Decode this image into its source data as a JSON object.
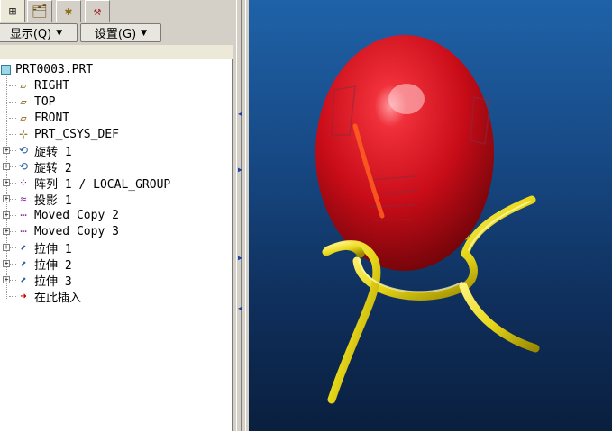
{
  "tabs": [
    {
      "icon": "model-tree-icon",
      "glyph": "⊞",
      "active": true
    },
    {
      "icon": "folder-browser-icon",
      "glyph": "🗂"
    },
    {
      "icon": "favorites-icon",
      "glyph": "✱"
    },
    {
      "icon": "tools-icon",
      "glyph": "⚒"
    }
  ],
  "toolbar": {
    "display_label": "显示(Q)",
    "settings_label": "设置(G)"
  },
  "tree": {
    "root": "PRT0003.PRT",
    "items": [
      {
        "label": "RIGHT",
        "icon": "datum-plane-icon",
        "glyph": "▱",
        "expandable": false
      },
      {
        "label": "TOP",
        "icon": "datum-plane-icon",
        "glyph": "▱",
        "expandable": false
      },
      {
        "label": "FRONT",
        "icon": "datum-plane-icon",
        "glyph": "▱",
        "expandable": false
      },
      {
        "label": "PRT_CSYS_DEF",
        "icon": "coordinate-system-icon",
        "glyph": "⊹",
        "expandable": false
      },
      {
        "label": "旋转 1",
        "icon": "revolve-icon",
        "glyph": "⟲",
        "expandable": true
      },
      {
        "label": "旋转 2",
        "icon": "revolve-icon",
        "glyph": "⟲",
        "expandable": true
      },
      {
        "label": "阵列 1 / LOCAL_GROUP",
        "icon": "pattern-icon",
        "glyph": "⁘",
        "expandable": true
      },
      {
        "label": "投影 1",
        "icon": "projection-icon",
        "glyph": "≈",
        "expandable": true
      },
      {
        "label": "Moved Copy 2",
        "icon": "moved-copy-icon",
        "glyph": "⋯",
        "expandable": true
      },
      {
        "label": "Moved Copy 3",
        "icon": "moved-copy-icon",
        "glyph": "⋯",
        "expandable": true
      },
      {
        "label": "拉伸 1",
        "icon": "extrude-icon",
        "glyph": "⬈",
        "expandable": true
      },
      {
        "label": "拉伸 2",
        "icon": "extrude-icon",
        "glyph": "⬈",
        "expandable": true
      },
      {
        "label": "拉伸 3",
        "icon": "extrude-icon",
        "glyph": "⬈",
        "expandable": true
      },
      {
        "label": "在此插入",
        "icon": "insert-here-arrow-icon",
        "glyph": "➜",
        "expandable": false
      }
    ]
  },
  "colors": {
    "egg": "#d0101a",
    "stand": "#e8d81a",
    "viewport_top": "#1f62a8",
    "viewport_bottom": "#0a1f3e",
    "insert_arrow": "#c00000"
  }
}
